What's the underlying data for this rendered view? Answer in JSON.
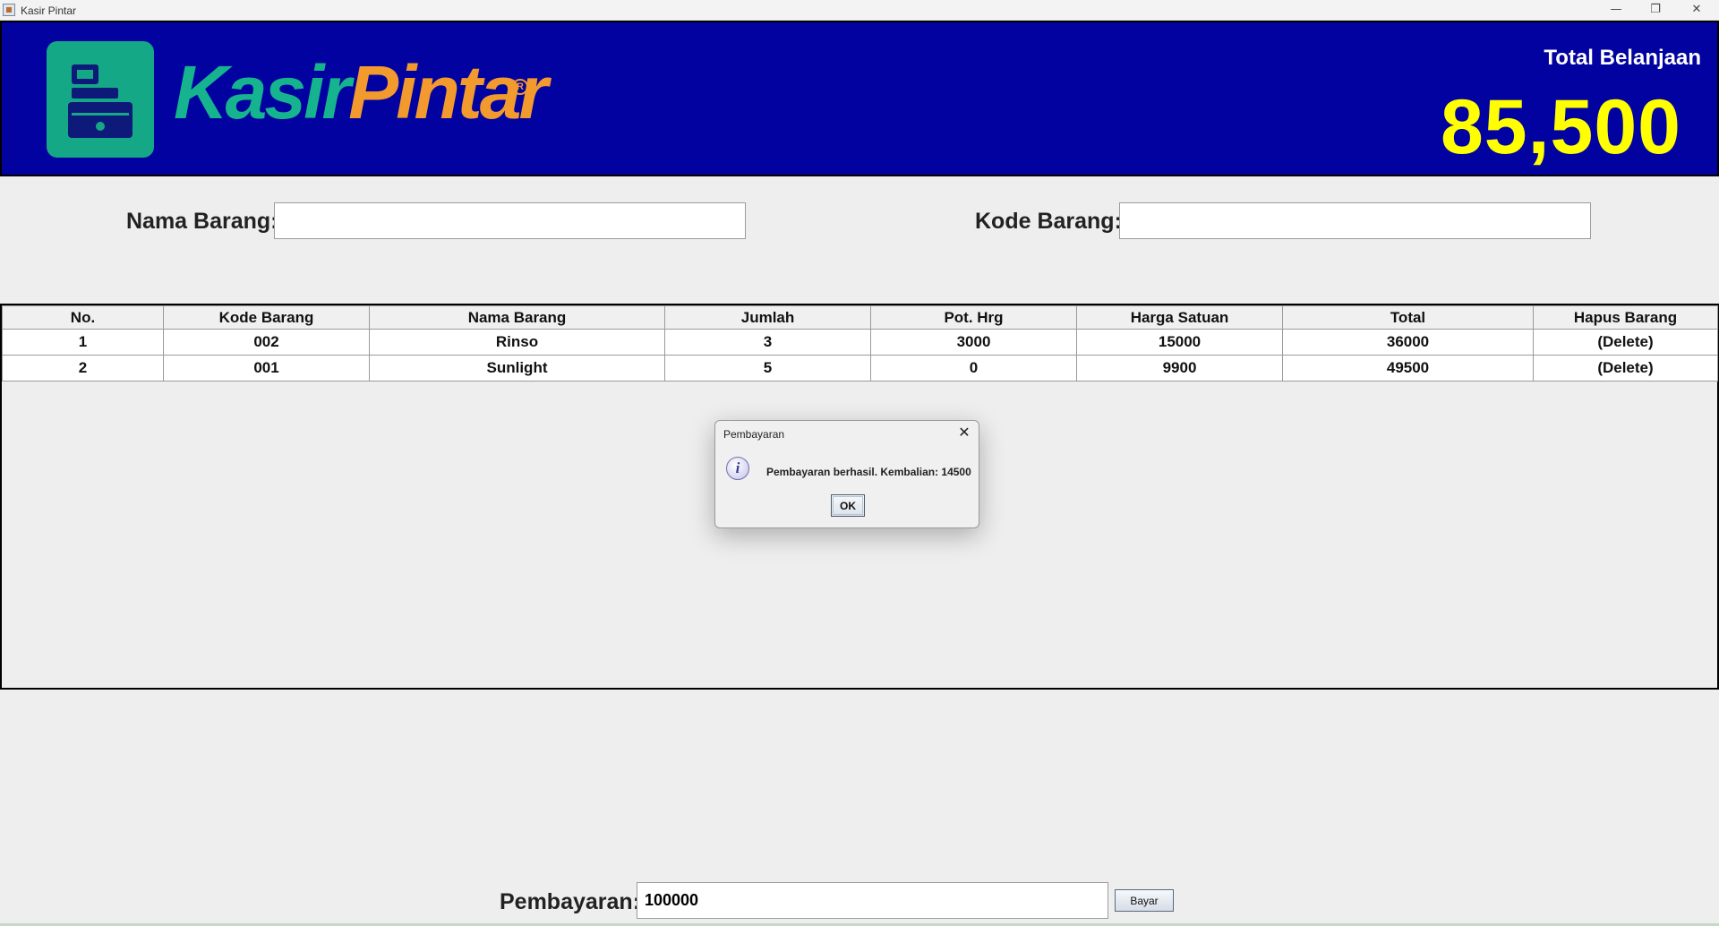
{
  "window": {
    "title": "Kasir Pintar",
    "minimize_glyph": "—",
    "restore_glyph": "❐",
    "close_glyph": "✕"
  },
  "header": {
    "logo_part1": "Kasir",
    "logo_part2": "Pintar",
    "logo_registered": "R",
    "total_label": "Total Belanjaan",
    "total_value": "85,500",
    "colors": {
      "banner": "#0202a0",
      "total_value": "#ffff00",
      "logo_green": "#16b48e",
      "logo_orange": "#f29a2e"
    }
  },
  "search": {
    "nama_label": "Nama Barang:",
    "nama_value": "",
    "kode_label": "Kode Barang:",
    "kode_value": ""
  },
  "table": {
    "columns": [
      "No.",
      "Kode Barang",
      "Nama Barang",
      "Jumlah",
      "Pot. Hrg",
      "Harga Satuan",
      "Total",
      "Hapus Barang"
    ],
    "rows": [
      [
        "1",
        "002",
        "Rinso",
        "3",
        "3000",
        "15000",
        "36000",
        "(Delete)"
      ],
      [
        "2",
        "001",
        "Sunlight",
        "5",
        "0",
        "9900",
        "49500",
        "(Delete)"
      ]
    ]
  },
  "dialog": {
    "title": "Pembayaran",
    "icon": "info-icon",
    "icon_glyph": "i",
    "message": "Pembayaran berhasil. Kembalian: 14500",
    "ok_label": "OK",
    "close_glyph": "✕"
  },
  "payment": {
    "label": "Pembayaran:",
    "value": "100000",
    "button_label": "Bayar"
  }
}
